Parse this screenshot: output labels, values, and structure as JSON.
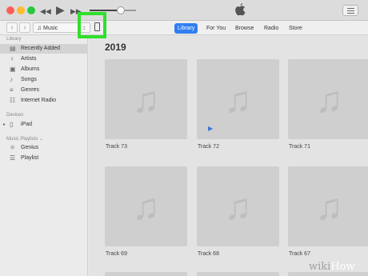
{
  "toolbar": {
    "traffic_colors": [
      "#ff5f57",
      "#febc2e",
      "#28c840"
    ],
    "rewind_icon": "◀◀",
    "play_icon": "▶",
    "forward_icon": "▶▶",
    "volume_level": 0.6,
    "list_icon": "list-icon"
  },
  "nav": {
    "back": "‹",
    "forward": "›",
    "media_label": "Music",
    "media_icon": "♫",
    "updown_icon": "↕",
    "tabs": [
      "Library",
      "For You",
      "Browse",
      "Radio",
      "Store"
    ]
  },
  "sidebar": {
    "library_header": "Library",
    "library_items": [
      {
        "label": "Recently Added",
        "icon": "▤"
      },
      {
        "label": "Artists",
        "icon": "♀"
      },
      {
        "label": "Albums",
        "icon": "▣"
      },
      {
        "label": "Songs",
        "icon": "♪"
      },
      {
        "label": "Genres",
        "icon": "≡"
      },
      {
        "label": "Internet Radio",
        "icon": "☷"
      }
    ],
    "devices_header": "Devices",
    "device": {
      "label": "iPad",
      "arrow": "▸",
      "icon": "▯"
    },
    "playlists_header": "Music Playlists ⌄",
    "playlists": [
      {
        "label": "Genius",
        "icon": "⚛"
      },
      {
        "label": "Playlist",
        "icon": "☰"
      }
    ]
  },
  "main": {
    "year": "2019",
    "note_icon": "♫",
    "play_badge": "▶",
    "tracks": [
      "Track 73",
      "Track 72",
      "Track 71",
      "Track 69",
      "Track 68",
      "Track 67"
    ]
  },
  "watermark": {
    "part1": "wiki",
    "part2": "How"
  }
}
